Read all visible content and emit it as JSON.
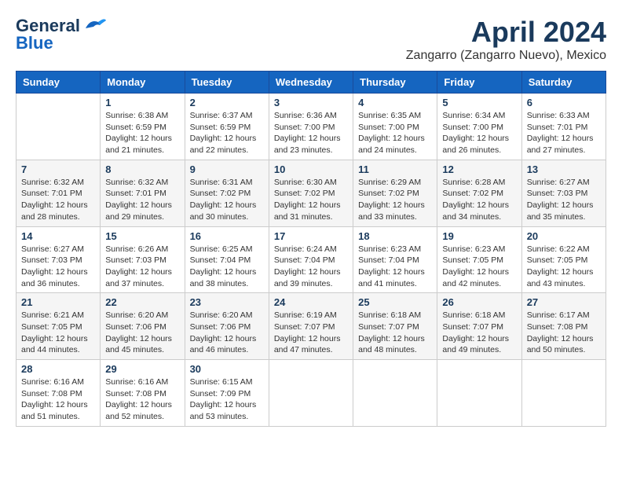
{
  "header": {
    "logo_line1": "General",
    "logo_line2": "Blue",
    "month": "April 2024",
    "location": "Zangarro (Zangarro Nuevo), Mexico"
  },
  "weekdays": [
    "Sunday",
    "Monday",
    "Tuesday",
    "Wednesday",
    "Thursday",
    "Friday",
    "Saturday"
  ],
  "weeks": [
    [
      {
        "day": "",
        "sunrise": "",
        "sunset": "",
        "daylight": ""
      },
      {
        "day": "1",
        "sunrise": "Sunrise: 6:38 AM",
        "sunset": "Sunset: 6:59 PM",
        "daylight": "Daylight: 12 hours and 21 minutes."
      },
      {
        "day": "2",
        "sunrise": "Sunrise: 6:37 AM",
        "sunset": "Sunset: 6:59 PM",
        "daylight": "Daylight: 12 hours and 22 minutes."
      },
      {
        "day": "3",
        "sunrise": "Sunrise: 6:36 AM",
        "sunset": "Sunset: 7:00 PM",
        "daylight": "Daylight: 12 hours and 23 minutes."
      },
      {
        "day": "4",
        "sunrise": "Sunrise: 6:35 AM",
        "sunset": "Sunset: 7:00 PM",
        "daylight": "Daylight: 12 hours and 24 minutes."
      },
      {
        "day": "5",
        "sunrise": "Sunrise: 6:34 AM",
        "sunset": "Sunset: 7:00 PM",
        "daylight": "Daylight: 12 hours and 26 minutes."
      },
      {
        "day": "6",
        "sunrise": "Sunrise: 6:33 AM",
        "sunset": "Sunset: 7:01 PM",
        "daylight": "Daylight: 12 hours and 27 minutes."
      }
    ],
    [
      {
        "day": "7",
        "sunrise": "Sunrise: 6:32 AM",
        "sunset": "Sunset: 7:01 PM",
        "daylight": "Daylight: 12 hours and 28 minutes."
      },
      {
        "day": "8",
        "sunrise": "Sunrise: 6:32 AM",
        "sunset": "Sunset: 7:01 PM",
        "daylight": "Daylight: 12 hours and 29 minutes."
      },
      {
        "day": "9",
        "sunrise": "Sunrise: 6:31 AM",
        "sunset": "Sunset: 7:02 PM",
        "daylight": "Daylight: 12 hours and 30 minutes."
      },
      {
        "day": "10",
        "sunrise": "Sunrise: 6:30 AM",
        "sunset": "Sunset: 7:02 PM",
        "daylight": "Daylight: 12 hours and 31 minutes."
      },
      {
        "day": "11",
        "sunrise": "Sunrise: 6:29 AM",
        "sunset": "Sunset: 7:02 PM",
        "daylight": "Daylight: 12 hours and 33 minutes."
      },
      {
        "day": "12",
        "sunrise": "Sunrise: 6:28 AM",
        "sunset": "Sunset: 7:02 PM",
        "daylight": "Daylight: 12 hours and 34 minutes."
      },
      {
        "day": "13",
        "sunrise": "Sunrise: 6:27 AM",
        "sunset": "Sunset: 7:03 PM",
        "daylight": "Daylight: 12 hours and 35 minutes."
      }
    ],
    [
      {
        "day": "14",
        "sunrise": "Sunrise: 6:27 AM",
        "sunset": "Sunset: 7:03 PM",
        "daylight": "Daylight: 12 hours and 36 minutes."
      },
      {
        "day": "15",
        "sunrise": "Sunrise: 6:26 AM",
        "sunset": "Sunset: 7:03 PM",
        "daylight": "Daylight: 12 hours and 37 minutes."
      },
      {
        "day": "16",
        "sunrise": "Sunrise: 6:25 AM",
        "sunset": "Sunset: 7:04 PM",
        "daylight": "Daylight: 12 hours and 38 minutes."
      },
      {
        "day": "17",
        "sunrise": "Sunrise: 6:24 AM",
        "sunset": "Sunset: 7:04 PM",
        "daylight": "Daylight: 12 hours and 39 minutes."
      },
      {
        "day": "18",
        "sunrise": "Sunrise: 6:23 AM",
        "sunset": "Sunset: 7:04 PM",
        "daylight": "Daylight: 12 hours and 41 minutes."
      },
      {
        "day": "19",
        "sunrise": "Sunrise: 6:23 AM",
        "sunset": "Sunset: 7:05 PM",
        "daylight": "Daylight: 12 hours and 42 minutes."
      },
      {
        "day": "20",
        "sunrise": "Sunrise: 6:22 AM",
        "sunset": "Sunset: 7:05 PM",
        "daylight": "Daylight: 12 hours and 43 minutes."
      }
    ],
    [
      {
        "day": "21",
        "sunrise": "Sunrise: 6:21 AM",
        "sunset": "Sunset: 7:05 PM",
        "daylight": "Daylight: 12 hours and 44 minutes."
      },
      {
        "day": "22",
        "sunrise": "Sunrise: 6:20 AM",
        "sunset": "Sunset: 7:06 PM",
        "daylight": "Daylight: 12 hours and 45 minutes."
      },
      {
        "day": "23",
        "sunrise": "Sunrise: 6:20 AM",
        "sunset": "Sunset: 7:06 PM",
        "daylight": "Daylight: 12 hours and 46 minutes."
      },
      {
        "day": "24",
        "sunrise": "Sunrise: 6:19 AM",
        "sunset": "Sunset: 7:07 PM",
        "daylight": "Daylight: 12 hours and 47 minutes."
      },
      {
        "day": "25",
        "sunrise": "Sunrise: 6:18 AM",
        "sunset": "Sunset: 7:07 PM",
        "daylight": "Daylight: 12 hours and 48 minutes."
      },
      {
        "day": "26",
        "sunrise": "Sunrise: 6:18 AM",
        "sunset": "Sunset: 7:07 PM",
        "daylight": "Daylight: 12 hours and 49 minutes."
      },
      {
        "day": "27",
        "sunrise": "Sunrise: 6:17 AM",
        "sunset": "Sunset: 7:08 PM",
        "daylight": "Daylight: 12 hours and 50 minutes."
      }
    ],
    [
      {
        "day": "28",
        "sunrise": "Sunrise: 6:16 AM",
        "sunset": "Sunset: 7:08 PM",
        "daylight": "Daylight: 12 hours and 51 minutes."
      },
      {
        "day": "29",
        "sunrise": "Sunrise: 6:16 AM",
        "sunset": "Sunset: 7:08 PM",
        "daylight": "Daylight: 12 hours and 52 minutes."
      },
      {
        "day": "30",
        "sunrise": "Sunrise: 6:15 AM",
        "sunset": "Sunset: 7:09 PM",
        "daylight": "Daylight: 12 hours and 53 minutes."
      },
      {
        "day": "",
        "sunrise": "",
        "sunset": "",
        "daylight": ""
      },
      {
        "day": "",
        "sunrise": "",
        "sunset": "",
        "daylight": ""
      },
      {
        "day": "",
        "sunrise": "",
        "sunset": "",
        "daylight": ""
      },
      {
        "day": "",
        "sunrise": "",
        "sunset": "",
        "daylight": ""
      }
    ]
  ]
}
